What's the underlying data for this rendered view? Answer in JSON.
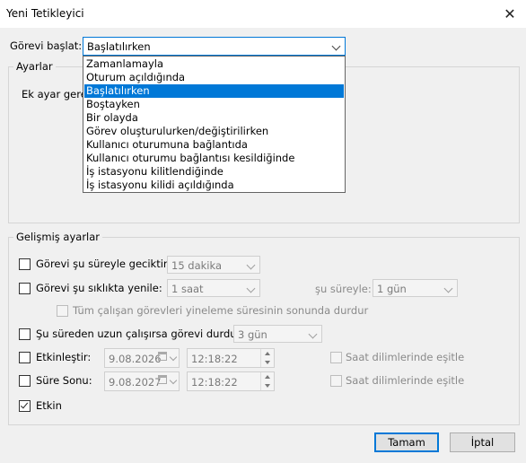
{
  "window": {
    "title": "Yeni Tetikleyici",
    "close_glyph": "✕"
  },
  "start_task": {
    "label": "Görevi başlat:",
    "selected": "Başlatılırken",
    "options": [
      "Zamanlamayla",
      "Oturum açıldığında",
      "Başlatılırken",
      "Boştayken",
      "Bir olayda",
      "Görev oluşturulurken/değiştirilirken",
      "Kullanıcı oturumuna bağlantıda",
      "Kullanıcı oturumu bağlantısı kesildiğinde",
      "İş istasyonu kilitlendiğinde",
      "İş istasyonu kilidi açıldığında"
    ]
  },
  "settings": {
    "legend": "Ayarlar",
    "text": "Ek ayar gerek"
  },
  "advanced": {
    "legend": "Gelişmiş ayarlar",
    "delay": {
      "label": "Görevi şu süreyle geciktir:",
      "value": "15 dakika",
      "checked": false
    },
    "repeat": {
      "label": "Görevi şu sıklıkta yenile:",
      "value": "1 saat",
      "duration_label": "şu süreyle:",
      "duration_value": "1 gün",
      "checked": false
    },
    "stop_all": {
      "label": "Tüm çalışan görevleri yineleme süresinin sonunda durdur",
      "checked": false
    },
    "stop_longer": {
      "label": "Şu süreden uzun çalışırsa görevi durdur:",
      "value": "3 gün",
      "checked": false
    },
    "activate": {
      "label": "Etkinleştir:",
      "date": "9.08.2026",
      "time": "12:18:22",
      "sync_label": "Saat dilimlerinde eşitle",
      "checked": false
    },
    "expire": {
      "label": "Süre Sonu:",
      "date": "9.08.2027",
      "time": "12:18:22",
      "sync_label": "Saat dilimlerinde eşitle",
      "checked": false
    },
    "enabled": {
      "label": "Etkin",
      "checked": true
    }
  },
  "buttons": {
    "ok": "Tamam",
    "cancel": "İptal"
  },
  "icons": {
    "close": "close-icon",
    "calendar": "calendar-icon",
    "dropdown": "chevron-down-icon"
  }
}
